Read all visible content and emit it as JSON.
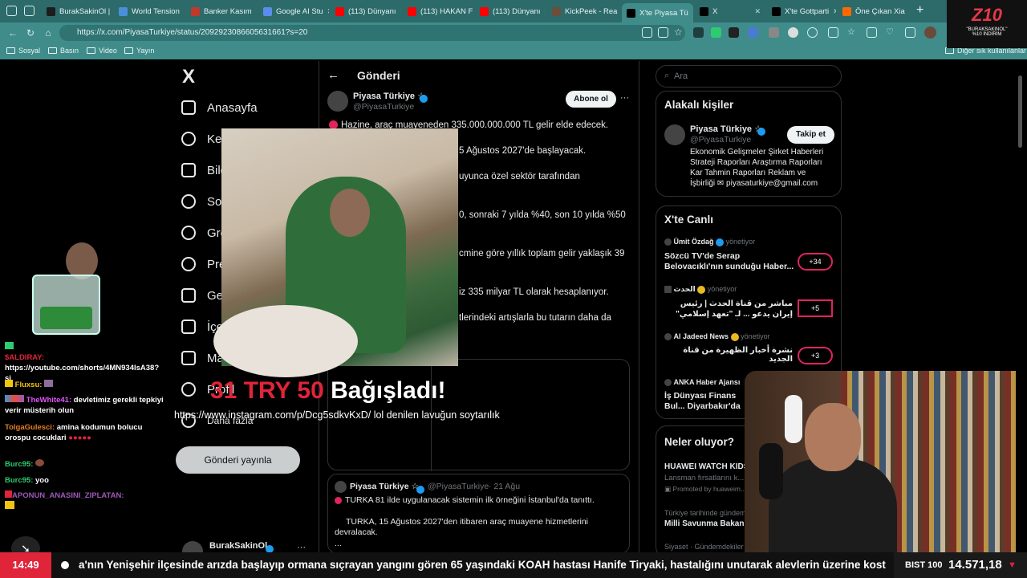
{
  "browser": {
    "tabs": [
      {
        "label": "BurakSakinOl |",
        "color": "#1d1d1d"
      },
      {
        "label": "World Tension",
        "color": "#4a90d9"
      },
      {
        "label": "Banker Kasım",
        "color": "#c0392b"
      },
      {
        "label": "Google AI Stu",
        "color": "#5b8def"
      },
      {
        "label": "(113) Dünyanı",
        "color": "#ff0000"
      },
      {
        "label": "(113) HAKAN F",
        "color": "#ff0000"
      },
      {
        "label": "(113) Dünyanı",
        "color": "#ff0000"
      },
      {
        "label": "KickPeek - Rea",
        "color": "#6b4f3a"
      },
      {
        "label": "X'te Piyasa Tü",
        "color": "#000000"
      },
      {
        "label": "X",
        "color": "#000000"
      },
      {
        "label": "X'te Gottparti",
        "color": "#000000"
      },
      {
        "label": "Öne Çıkan Xia",
        "color": "#ff6900"
      }
    ],
    "url": "https://x.com/PiyasaTurkiye/status/2092923086605631661?s=20",
    "bookmarks": [
      "Sosyal",
      "Basın",
      "Video",
      "Yayın"
    ],
    "other_bookmarks": "Diğer sık kullanılanlar"
  },
  "ad": {
    "logo": "Z10",
    "line1": "\"BURAKSAKINOL\"",
    "line2": "%10 İNDİRİM"
  },
  "nav": {
    "logo": "X",
    "items": [
      "Anasayfa",
      "Keşfet",
      "Bildirimler",
      "Sohbet",
      "Grok",
      "Premium",
      "Gelen",
      "İçerik",
      "Mağaza",
      "Profil",
      "Daha fazla"
    ],
    "post_button": "Gönderi yayınla",
    "account_name": "BurakSakinOl"
  },
  "post": {
    "header": "Gönderi",
    "author_name": "Piyasa Türkiye ☆",
    "author_handle": "@PiyasaTurkiye",
    "subscribe": "Abone ol",
    "lines": [
      "Hazine, araç muayeneden 335.000.000.000 TL gelir elde edecek.",
      "5 Ağustos 2027'de başlayacak.",
      "uyunca özel sektör tarafından",
      "0, sonraki 7 yılda %40, son 10 yılda %50",
      "cmine göre yıllık toplam gelir yaklaşık 39",
      "iz 335 milyar TL olarak hesaplanıyor.",
      "tlerindeki artışlarla bu tutarın daha da"
    ],
    "quoted": {
      "author": "Piyasa Türkiye ☆",
      "handle": "@PiyasaTurkiye",
      "date": "· 21 Ağu",
      "line1": "TURKA 81 ilde uygulanacak sistemin ilk örneğini İstanbul'da tanıttı.",
      "line2": "TURKA, 15 Ağustos 2027'den itibaren araç muayene hizmetlerini",
      "line3": "devralacak.",
      "line4": "..."
    }
  },
  "right": {
    "search_placeholder": "Ara",
    "related_title": "Alakalı kişiler",
    "related": {
      "name": "Piyasa Türkiye ☆",
      "handle": "@PiyasaTurkiye",
      "follow": "Takip et",
      "bio": [
        "Ekonomik Gelişmeler Şirket Haberleri",
        "Strateji Raporları Araştırma Raporları",
        "Kar Tahmin Raporları Reklam ve",
        "İşbirliği ✉ piyasaturkiye@gmail.com"
      ]
    },
    "live_title": "X'te Canlı",
    "live": [
      {
        "host": "Ümit Özdağ",
        "role": "yönetiyor",
        "title": "Sözcü TV'de Serap Belovacıklı'nın sunduğu Haber...",
        "count": "+34"
      },
      {
        "host": "الحدث",
        "role": "yönetiyor",
        "title": "مباشر من قناة الحدث | رئيس إيران يدعو ... لـ \"تعهد إسلامي\" بعدم زعزعة الأمن",
        "count": "+5"
      },
      {
        "host": "Al Jadeed News",
        "role": "yönetiyor",
        "title": "نشرة أخبار الظهيرة من قناة الجديد",
        "count": "+3"
      },
      {
        "host": "ANKA Haber Ajansı",
        "role": "",
        "title": "İş Dünyası Finans Bul... Diyarbakır'da gerçek...",
        "count": ""
      }
    ],
    "trends_title": "Neler oluyor?",
    "trends": [
      {
        "title": "HUAWEI WATCH KIDS",
        "sub": "Lansman fırsatlarını k...",
        "promo": "Promoted by huaweim..."
      },
      {
        "title": "Milli Savunma Bakanlığı",
        "sub": "Türkiye tarihinde gündem...",
        "promo": ""
      },
      {
        "title": "",
        "sub": "Siyaset · Gündemdekiler",
        "promo": ""
      }
    ]
  },
  "overlay": {
    "donation_amount": "31 TRY 50",
    "donation_label": "Bağışladı!",
    "donation_message": "https://www.instagram.com/p/Dcg5sdkvKxD/ lol denilen lavuğun soytarılık"
  },
  "chat": [
    {
      "user": "$ALDIRAY:",
      "text": "https://youtube.com/shorts/4MN934IsA38?si",
      "color": "#e0243a"
    },
    {
      "user": "Fluxsu:",
      "text": "",
      "color": "#f1c40f"
    },
    {
      "user": "TheWhite41:",
      "text": "devletimiz gerekli tepkiyi verir müsterih olun",
      "color": "#e056fd"
    },
    {
      "user": "TolgaGulesci:",
      "text": "amina kodumun bolucu orospu cocuklari",
      "color": "#e67e22"
    },
    {
      "user": "Burc95:",
      "text": "",
      "color": "#2ecc71"
    },
    {
      "user": "Burc95:",
      "text": "yoo",
      "color": "#2ecc71"
    },
    {
      "user": "APONUN_ANASINI_ZIPLATAN:",
      "text": "",
      "color": "#9b59b6"
    }
  ],
  "ticker": {
    "time": "14:49",
    "text": "a'nın Yenişehir ilçesinde arızda başlayıp ormana sıçrayan yangını gören 65 yaşındaki KOAH hastası Hanife Tiryaki, hastalığını unutarak alevlerin üzerine kost",
    "index_label": "BIST 100",
    "index_value": "14.571,18",
    "index_arrow": "▼"
  }
}
